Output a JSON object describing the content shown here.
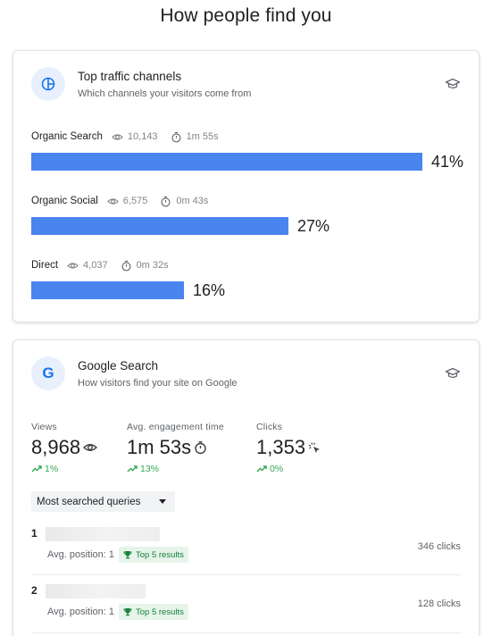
{
  "page_title": "How people find you",
  "traffic_card": {
    "title": "Top traffic channels",
    "subtitle": "Which channels your visitors come from",
    "channels": [
      {
        "name": "Organic Search",
        "views": "10,143",
        "time": "1m 55s",
        "percent_label": "41%",
        "fill": 0.41
      },
      {
        "name": "Organic Social",
        "views": "6,575",
        "time": "0m 43s",
        "percent_label": "27%",
        "fill": 0.27
      },
      {
        "name": "Direct",
        "views": "4,037",
        "time": "0m 32s",
        "percent_label": "16%",
        "fill": 0.16
      }
    ]
  },
  "search_card": {
    "icon_letter": "G",
    "title": "Google Search",
    "subtitle": "How visitors find your site on Google",
    "metrics": [
      {
        "label": "Views",
        "value": "8,968",
        "icon": "eye-icon",
        "delta": "1%"
      },
      {
        "label": "Avg. engagement time",
        "value": "1m 53s",
        "icon": "timer-icon",
        "delta": "13%"
      },
      {
        "label": "Clicks",
        "value": "1,353",
        "icon": "click-icon",
        "delta": "0%"
      }
    ],
    "dropdown_label": "Most searched queries",
    "queries": [
      {
        "rank": "1",
        "position_text": "Avg. position: 1",
        "badge": "Top 5 results",
        "clicks": "346 clicks"
      },
      {
        "rank": "2",
        "position_text": "Avg. position: 1",
        "badge": "Top 5 results",
        "clicks": "128 clicks"
      }
    ]
  },
  "colors": {
    "bar": "#4a84ef",
    "positive": "#34a853",
    "badge_bg": "#e6f4ea",
    "icon_bg": "#e8f0fe",
    "accent_blue": "#1a73e8"
  }
}
